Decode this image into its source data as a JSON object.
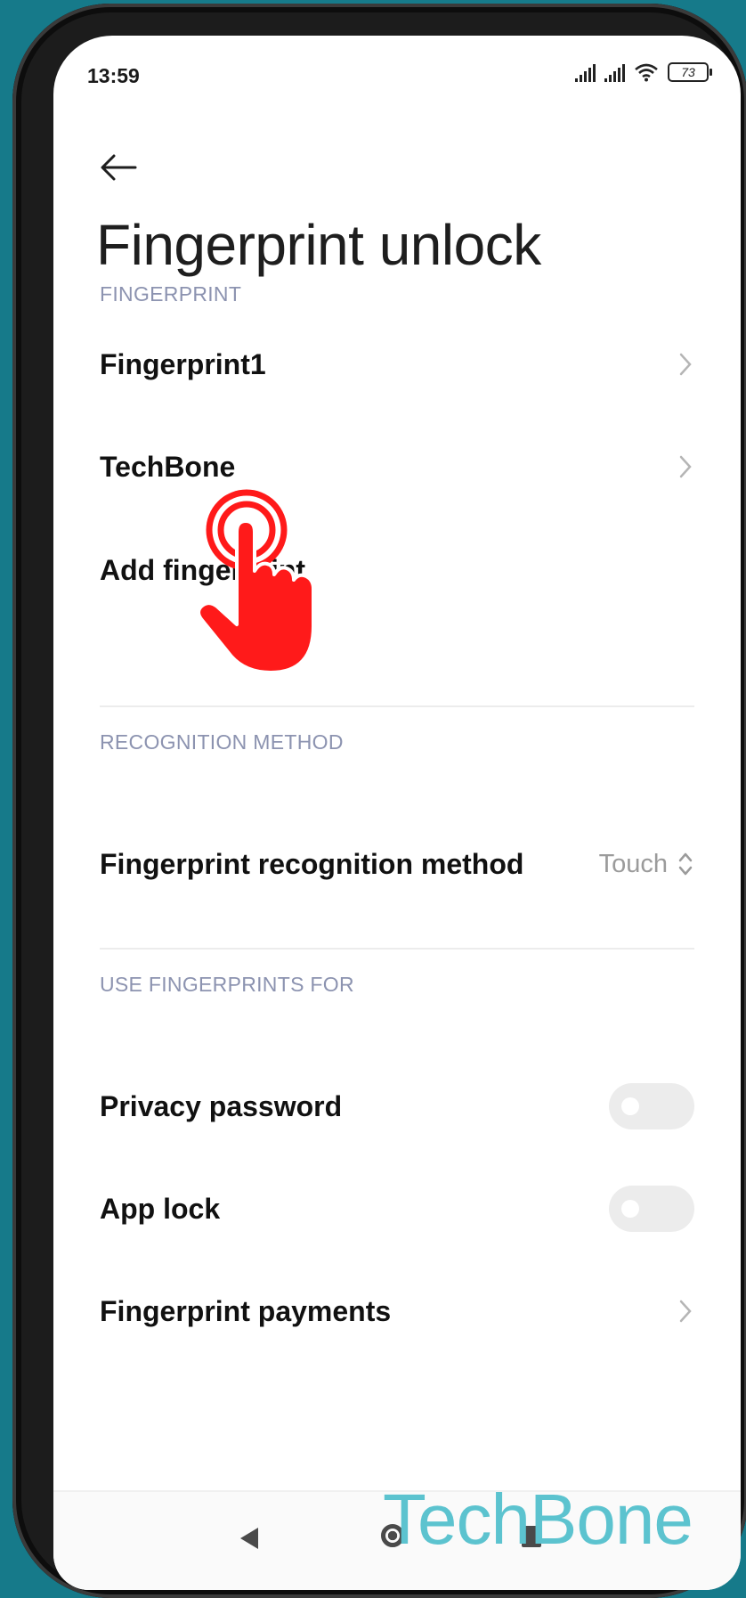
{
  "status_bar": {
    "time": "13:59",
    "battery": "73"
  },
  "header": {
    "title": "Fingerprint unlock"
  },
  "sections": {
    "fingerprint": {
      "header": "FINGERPRINT",
      "items": [
        {
          "label": "Fingerprint1"
        },
        {
          "label": "TechBone"
        },
        {
          "label": "Add fingerprint"
        }
      ]
    },
    "recognition": {
      "header": "RECOGNITION METHOD",
      "item_label": "Fingerprint recognition method",
      "item_value": "Touch"
    },
    "use_for": {
      "header": "USE FINGERPRINTS FOR",
      "privacy_password": {
        "label": "Privacy password",
        "enabled": false
      },
      "app_lock": {
        "label": "App lock",
        "enabled": false
      },
      "payments": {
        "label": "Fingerprint payments"
      }
    }
  },
  "watermark": "TechBone",
  "colors": {
    "background": "#167a8a",
    "section_header": "#8c93b0",
    "watermark": "#5cc3cf",
    "tap_indicator": "#ff1a1a"
  },
  "icons": {
    "back": "arrow-left-icon",
    "chevron": "chevron-right-icon",
    "selector": "up-down-chevron-icon",
    "tap": "tap-hand-icon"
  }
}
